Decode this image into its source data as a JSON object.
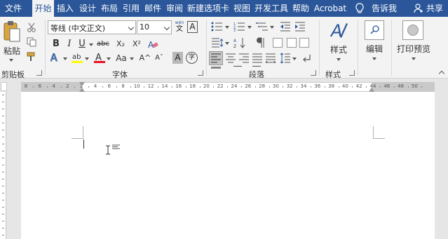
{
  "tabs": {
    "file": "文件",
    "items": [
      "开始",
      "插入",
      "设计",
      "布局",
      "引用",
      "邮件",
      "审阅",
      "新建选项卡",
      "视图",
      "开发工具",
      "帮助",
      "Acrobat"
    ],
    "tell_me": "告诉我",
    "share": "共享"
  },
  "clipboard": {
    "paste": "粘贴",
    "group": "剪贴板"
  },
  "font": {
    "name": "等线 (中文正文)",
    "size": "10",
    "wen_top": "wén",
    "wen_bottom": "文",
    "bold": "B",
    "italic": "I",
    "underline": "U",
    "strike": "abc",
    "subscript": "X₂",
    "superscript": "X²",
    "grow": "A^",
    "shrink": "Aˇ",
    "case": "Aa",
    "char_shade": "A",
    "enclose": "字",
    "group": "字体"
  },
  "paragraph": {
    "group": "段落"
  },
  "styles": {
    "label": "样式",
    "group": "样式"
  },
  "editing": {
    "label": "编辑"
  },
  "print_preview": {
    "label": "打印预览"
  },
  "ruler": {
    "labels": [
      "8",
      "6",
      "4",
      "2",
      "2",
      "4",
      "6",
      "8",
      "10",
      "12",
      "14",
      "16",
      "18",
      "20",
      "22",
      "24",
      "26",
      "28",
      "30",
      "32",
      "34",
      "36",
      "38",
      "40",
      "42",
      "44",
      "46",
      "48",
      "50"
    ]
  },
  "colors": {
    "accent": "#2b579a",
    "font_color": "#e81123",
    "highlight": "#ffff00"
  }
}
